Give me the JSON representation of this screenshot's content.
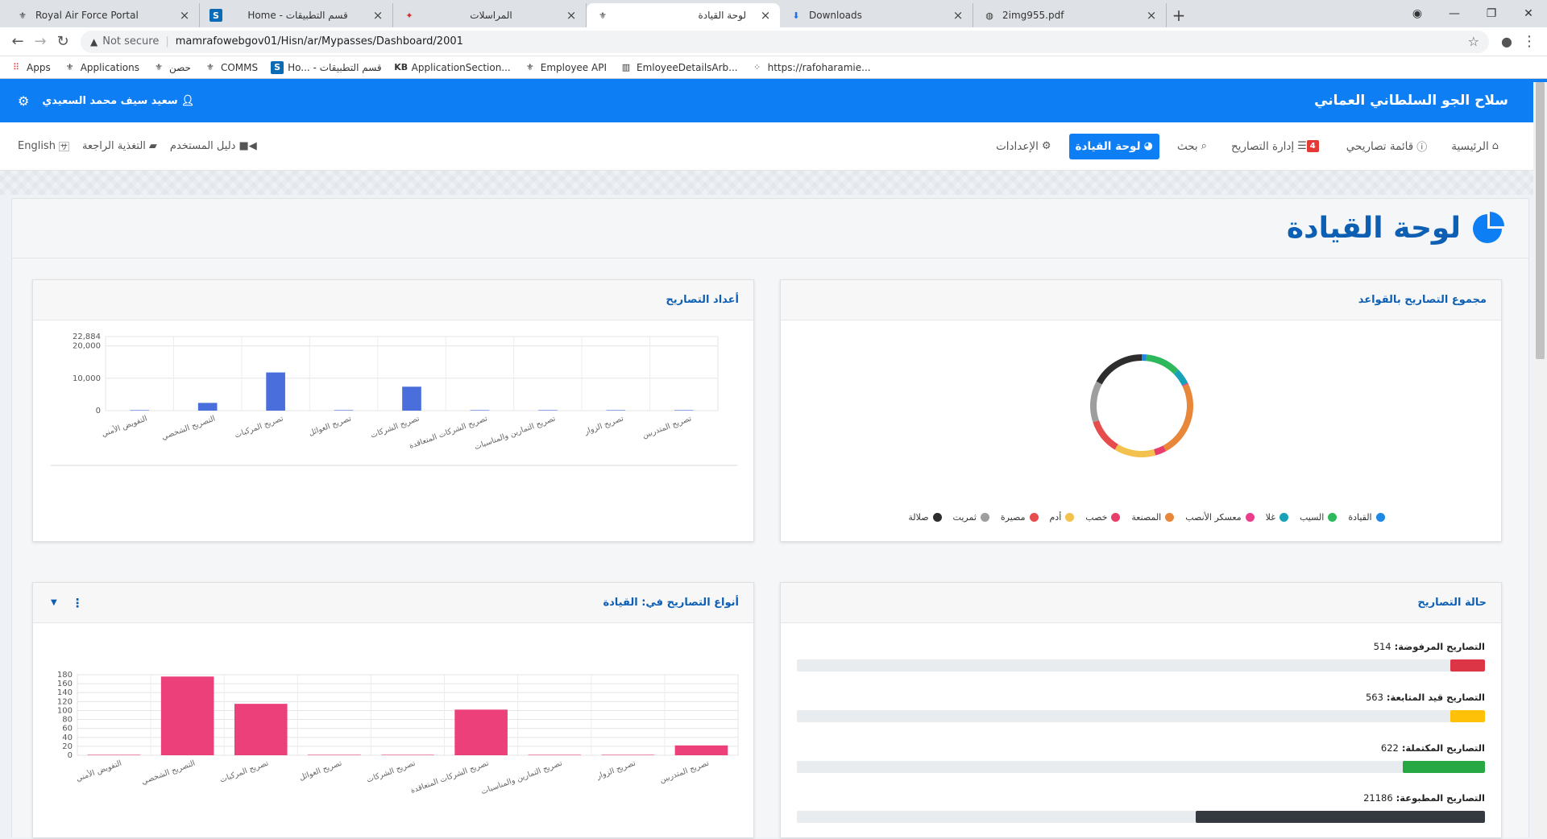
{
  "browser": {
    "tabs": [
      {
        "title": "Royal Air Force Portal",
        "icon": "emblem",
        "active": false
      },
      {
        "title": "Home - قسم التطبيقات",
        "icon": "sharepoint",
        "active": false
      },
      {
        "title": "المراسلات",
        "icon": "emblem-red",
        "active": false
      },
      {
        "title": "لوحة القيادة",
        "icon": "emblem",
        "active": true
      },
      {
        "title": "Downloads",
        "icon": "download",
        "active": false
      },
      {
        "title": "2img955.pdf",
        "icon": "globe",
        "active": false
      }
    ],
    "not_secure": "Not secure",
    "url": "mamrafowebgov01/Hisn/ar/Mypasses/Dashboard/2001",
    "bookmarks": [
      {
        "label": "Apps",
        "icon": "apps-grid"
      },
      {
        "label": "Applications",
        "icon": "emblem"
      },
      {
        "label": "حصن",
        "icon": "emblem"
      },
      {
        "label": "COMMS",
        "icon": "emblem"
      },
      {
        "label": "Ho... - قسم التطبيقات",
        "icon": "sharepoint"
      },
      {
        "label": "ApplicationSection...",
        "icon": "kb"
      },
      {
        "label": "Employee API",
        "icon": "emblem"
      },
      {
        "label": "EmloyeeDetailsArb...",
        "icon": "chart"
      },
      {
        "label": "https://rafoharamie...",
        "icon": "dots"
      }
    ]
  },
  "header": {
    "org_name": "سلاح الجو السلطاني العماني",
    "user_name": "سعيد سيف محمد السعيدي"
  },
  "menu": {
    "right": [
      {
        "label": "الرئيسية",
        "icon": "home-icon"
      },
      {
        "label": "قائمة تصاريحي",
        "icon": "info-circle-icon"
      },
      {
        "label": "إدارة التصاريح",
        "icon": "list-icon",
        "badge": "4"
      },
      {
        "label": "بحث",
        "icon": "search-icon"
      },
      {
        "label": "لوحة القيادة",
        "icon": "pie-chart-icon",
        "active": true
      },
      {
        "label": "الإعدادات",
        "icon": "cogs-icon"
      }
    ],
    "left": [
      {
        "label": "دليل المستخدم",
        "icon": "video-icon"
      },
      {
        "label": "التغذية الراجعة",
        "icon": "comment-icon"
      },
      {
        "label": "English",
        "icon": "language-icon"
      }
    ]
  },
  "page": {
    "title": "لوحة القيادة"
  },
  "cards": {
    "donut": {
      "title": "مجموع التصاريح بالقواعد"
    },
    "counts": {
      "title": "أعداد التصاريح"
    },
    "status": {
      "title": "حالة التصاريح"
    },
    "types": {
      "title": "أنواع التصاريح في: القيادة"
    }
  },
  "status_items": [
    {
      "label": "التصاريح المرفوضة:",
      "count": "514",
      "fraction": 0.05,
      "color": "#dc3545"
    },
    {
      "label": "التصاريح قيد المتابعة:",
      "count": "563",
      "fraction": 0.05,
      "color": "#ffc107"
    },
    {
      "label": "التصاريح المكتملة:",
      "count": "622",
      "fraction": 0.12,
      "color": "#28a745"
    },
    {
      "label": "التصاريح المطبوعة:",
      "count": "21186",
      "fraction": 0.42,
      "color": "#343a40"
    }
  ],
  "chart_data": [
    {
      "type": "pie",
      "title": "",
      "donut": true,
      "legend_position": "bottom",
      "labels": [
        "القيادة",
        "السيب",
        "غلا",
        "معسكر الأنصب",
        "المصنعة",
        "خصب",
        "أدم",
        "مصيرة",
        "ثمريت",
        "صلالة"
      ],
      "colors": [
        "#1e88e5",
        "#2eb85c",
        "#17a2b8",
        "#e83e8c",
        "#e8873a",
        "#e83e6c",
        "#f2c14e",
        "#e74c4c",
        "#9e9e9e",
        "#2d2d2d"
      ],
      "values": [
        1.5,
        11,
        5,
        0.4,
        24,
        3.5,
        13,
        11,
        13,
        17
      ]
    },
    {
      "type": "bar",
      "title": "",
      "categories": [
        "التفويض الأمني",
        "التصريح الشخصي",
        "تصريح المركبات",
        "تصريح العوائل",
        "تصريح الشركات",
        "تصريح الشركات المتعاقدة",
        "تصريح التمارين والمناسبات",
        "تصريح الزوار",
        "تصريح المتدربين"
      ],
      "values": [
        0,
        2400,
        11800,
        80,
        7400,
        60,
        0,
        120,
        0
      ],
      "ylim": [
        0,
        22884
      ],
      "yticks": [
        "0",
        "10,000",
        "20,000",
        "22,884"
      ],
      "color": "#4a6fdc",
      "grid": true
    },
    {
      "type": "bar",
      "title": "",
      "categories": [
        "التفويض الأمني",
        "التصريح الشخصي",
        "تصريح المركبات",
        "تصريح العوائل",
        "تصريح الشركات",
        "تصريح الشركات المتعاقدة",
        "تصريح التمارين والمناسبات",
        "تصريح الزوار",
        "تصريح المتدربين"
      ],
      "values": [
        0,
        176,
        115,
        0,
        0,
        102,
        0,
        0,
        22
      ],
      "ylim": [
        0,
        180
      ],
      "yticks": [
        "0",
        "20",
        "40",
        "60",
        "80",
        "100",
        "120",
        "140",
        "160",
        "180"
      ],
      "color": "#ec407a",
      "grid": true
    }
  ]
}
